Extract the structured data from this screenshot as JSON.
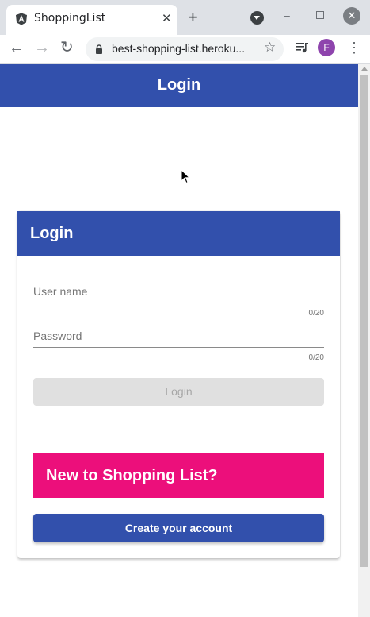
{
  "browser": {
    "tab_title": "ShoppingList",
    "tab_close": "✕",
    "new_tab": "+",
    "url": "best-shopping-list.heroku...",
    "profile_initial": "F"
  },
  "app": {
    "toolbar_title": "Login"
  },
  "login_card": {
    "header": "Login",
    "username": {
      "label": "User name",
      "counter": "0/20",
      "value": ""
    },
    "password": {
      "label": "Password",
      "counter": "0/20",
      "value": ""
    },
    "login_button": "Login",
    "login_button_disabled": true,
    "promo_title": "New to Shopping List?",
    "create_account_button": "Create your account"
  },
  "colors": {
    "primary": "#3250ac",
    "accent": "#ec0f7b",
    "disabled_bg": "#e0e0e0"
  },
  "icons": [
    "angular-favicon",
    "close-icon",
    "plus-icon",
    "tab-search-icon",
    "minimize-icon",
    "maximize-icon",
    "window-close-icon",
    "back-arrow-icon",
    "forward-arrow-icon",
    "reload-icon",
    "lock-icon",
    "star-icon",
    "media-control-icon",
    "kebab-menu-icon",
    "mouse-cursor"
  ]
}
